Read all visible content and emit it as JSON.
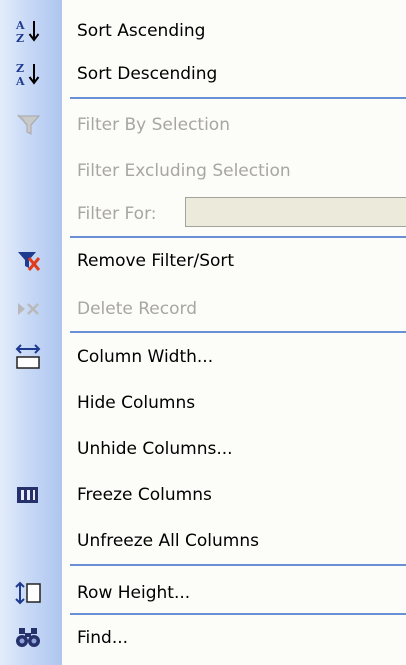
{
  "menu": {
    "items": [
      {
        "key": "sort_asc",
        "label": "Sort Ascending",
        "icon": "sort-ascending-icon"
      },
      {
        "key": "sort_desc",
        "label": "Sort Descending",
        "icon": "sort-descending-icon"
      },
      {
        "key": "filter_by_selection",
        "label": "Filter By Selection",
        "icon": "filter-selection-icon",
        "disabled": true
      },
      {
        "key": "filter_excluding",
        "label": "Filter Excluding Selection",
        "disabled": true
      },
      {
        "key": "filter_for",
        "label": "Filter For:",
        "disabled": true,
        "input_value": ""
      },
      {
        "key": "remove_filter",
        "label": "Remove Filter/Sort",
        "icon": "remove-filter-icon"
      },
      {
        "key": "delete_record",
        "label": "Delete Record",
        "icon": "delete-record-icon",
        "disabled": true
      },
      {
        "key": "column_width",
        "label": "Column Width...",
        "icon": "column-width-icon"
      },
      {
        "key": "hide_columns",
        "label": "Hide Columns"
      },
      {
        "key": "unhide_columns",
        "label": "Unhide Columns..."
      },
      {
        "key": "freeze_columns",
        "label": "Freeze Columns",
        "icon": "freeze-columns-icon"
      },
      {
        "key": "unfreeze_all",
        "label": "Unfreeze All Columns"
      },
      {
        "key": "row_height",
        "label": "Row Height...",
        "icon": "row-height-icon"
      },
      {
        "key": "find",
        "label": "Find...",
        "icon": "binoculars-icon"
      }
    ]
  },
  "colors": {
    "gutter": "#c8d9f6",
    "separator": "#6a8fd6",
    "disabled_text": "#a7a6a0",
    "menu_background": "#fcfcf9"
  }
}
